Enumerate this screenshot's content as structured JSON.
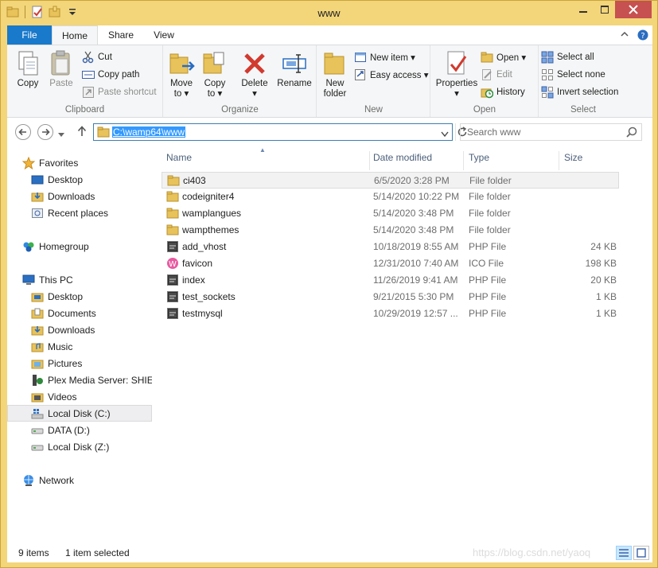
{
  "window": {
    "title": "www"
  },
  "quick_access": {
    "icons": [
      "folder-icon",
      "properties-icon",
      "new-folder-icon",
      "customize-dropdown-icon"
    ]
  },
  "ribbon_tabs": {
    "file": "File",
    "home": "Home",
    "share": "Share",
    "view": "View"
  },
  "ribbon": {
    "clipboard": {
      "label": "Clipboard",
      "copy": "Copy",
      "paste": "Paste",
      "cut": "Cut",
      "copy_path": "Copy path",
      "paste_shortcut": "Paste shortcut"
    },
    "organize": {
      "label": "Organize",
      "move_to_1": "Move",
      "move_to_2": "to ▾",
      "copy_to_1": "Copy",
      "copy_to_2": "to ▾",
      "delete_1": "Delete",
      "delete_2": "▾",
      "rename": "Rename"
    },
    "new": {
      "label": "New",
      "new_folder_1": "New",
      "new_folder_2": "folder",
      "new_item": "New item ▾",
      "easy_access": "Easy access ▾"
    },
    "open": {
      "label": "Open",
      "properties_1": "Properties",
      "properties_2": "▾",
      "open": "Open ▾",
      "edit": "Edit",
      "history": "History"
    },
    "select": {
      "label": "Select",
      "select_all": "Select all",
      "select_none": "Select none",
      "invert_selection": "Invert selection"
    }
  },
  "address": {
    "path": "C:\\wamp64\\www",
    "search_placeholder": "Search www"
  },
  "nav": {
    "favorites": "Favorites",
    "desktop": "Desktop",
    "downloads": "Downloads",
    "recent_places": "Recent places",
    "homegroup": "Homegroup",
    "this_pc": "This PC",
    "pc_desktop": "Desktop",
    "documents": "Documents",
    "pc_downloads": "Downloads",
    "music": "Music",
    "pictures": "Pictures",
    "plex": "Plex Media Server: SHIEL",
    "videos": "Videos",
    "local_disk_c": "Local Disk (C:)",
    "data_d": "DATA (D:)",
    "local_disk_z": "Local Disk (Z:)",
    "network": "Network"
  },
  "columns": {
    "name": "Name",
    "date": "Date modified",
    "type": "Type",
    "size": "Size"
  },
  "files": [
    {
      "name": "ci403",
      "date": "6/5/2020 3:28 PM",
      "type": "File folder",
      "size": "",
      "icon": "folder-icon",
      "selected": true
    },
    {
      "name": "codeigniter4",
      "date": "5/14/2020 10:22 PM",
      "type": "File folder",
      "size": "",
      "icon": "folder-icon",
      "selected": false
    },
    {
      "name": "wamplangues",
      "date": "5/14/2020 3:48 PM",
      "type": "File folder",
      "size": "",
      "icon": "folder-icon",
      "selected": false
    },
    {
      "name": "wampthemes",
      "date": "5/14/2020 3:48 PM",
      "type": "File folder",
      "size": "",
      "icon": "folder-icon",
      "selected": false
    },
    {
      "name": "add_vhost",
      "date": "10/18/2019 8:55 AM",
      "type": "PHP File",
      "size": "24 KB",
      "icon": "php-file-icon",
      "selected": false
    },
    {
      "name": "favicon",
      "date": "12/31/2010 7:40 AM",
      "type": "ICO File",
      "size": "198 KB",
      "icon": "ico-file-icon",
      "selected": false
    },
    {
      "name": "index",
      "date": "11/26/2019 9:41 AM",
      "type": "PHP File",
      "size": "20 KB",
      "icon": "php-file-icon",
      "selected": false
    },
    {
      "name": "test_sockets",
      "date": "9/21/2015 5:30 PM",
      "type": "PHP File",
      "size": "1 KB",
      "icon": "php-file-icon",
      "selected": false
    },
    {
      "name": "testmysql",
      "date": "10/29/2019 12:57 ...",
      "type": "PHP File",
      "size": "1 KB",
      "icon": "php-file-icon",
      "selected": false
    }
  ],
  "status": {
    "item_count": "9 items",
    "selected": "1 item selected",
    "watermark": "https://blog.csdn.net/yaoq"
  },
  "colors": {
    "file_tab": "#1979ca",
    "selection": "#3399ff",
    "frame": "#f3d57a",
    "close": "#c75050"
  }
}
